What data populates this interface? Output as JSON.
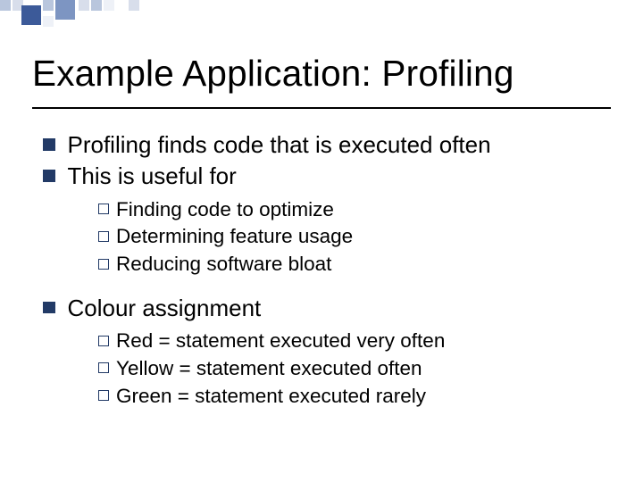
{
  "title": "Example Application: Profiling",
  "bullets": [
    {
      "text": "Profiling finds code that is executed often"
    },
    {
      "text": "This is useful for",
      "children": [
        "Finding code to optimize",
        "Determining feature usage",
        "Reducing software bloat"
      ]
    },
    {
      "text": "Colour assignment",
      "children": [
        "Red = statement executed very often",
        "Yellow = statement executed often",
        "Green = statement executed rarely"
      ]
    }
  ]
}
